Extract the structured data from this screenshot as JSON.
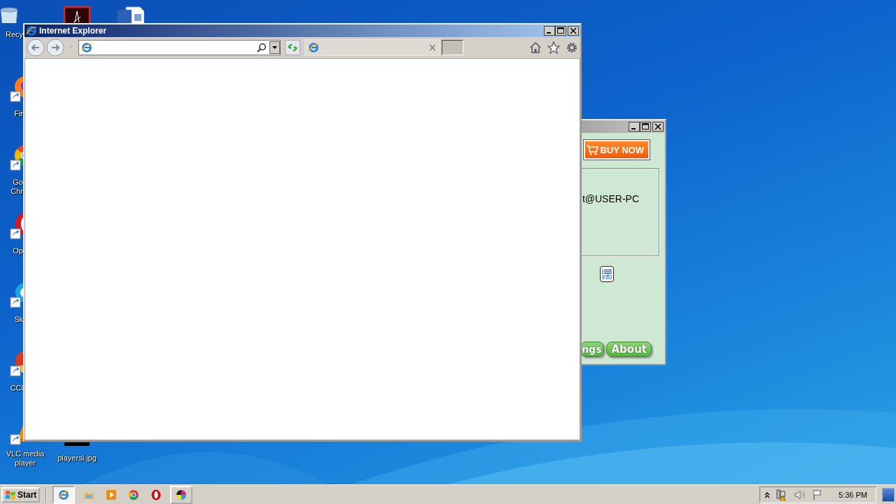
{
  "desktop": {
    "icons": [
      {
        "kind": "bin",
        "label": "Recy"
      },
      {
        "kind": "pdf"
      },
      {
        "kind": "doc"
      },
      {
        "kind": "firefox",
        "label": "Fir"
      },
      {
        "kind": "chrome",
        "label": "Go\nChr"
      },
      {
        "kind": "opera",
        "label": "Op"
      },
      {
        "kind": "skype",
        "label": "Sk"
      },
      {
        "kind": "ccleaner",
        "label": "CCl"
      },
      {
        "kind": "vlc",
        "label": "VLC media player"
      },
      {
        "kind": "image",
        "label": "playersi.jpg"
      }
    ]
  },
  "background_window": {
    "buy_button": "BUY NOW",
    "account_text": "t@USER-PC",
    "info_text": "info",
    "buttons": [
      "ngs",
      "About"
    ]
  },
  "browser_window": {
    "title": "Internet Explorer",
    "tab_close": "×"
  },
  "taskbar": {
    "start": "Start",
    "items": [
      {
        "kind": "ie",
        "window": true,
        "selected": true
      },
      {
        "kind": "folder",
        "window": false,
        "selected": false
      },
      {
        "kind": "media",
        "window": false,
        "selected": false
      },
      {
        "kind": "chrome",
        "window": false,
        "selected": false
      },
      {
        "kind": "opera",
        "window": false,
        "selected": false
      },
      {
        "kind": "paint",
        "window": true,
        "selected": false
      }
    ],
    "clock": "5:36 PM"
  }
}
